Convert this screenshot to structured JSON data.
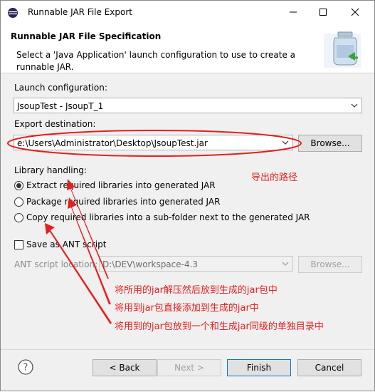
{
  "window": {
    "title": "Runnable JAR File Export"
  },
  "header": {
    "title": "Runnable JAR File Specification",
    "description": "Select a 'Java Application' launch configuration to use to create a runnable JAR."
  },
  "launch": {
    "label": "Launch configuration:",
    "value": "JsoupTest - JsoupT_1"
  },
  "export": {
    "label": "Export destination:",
    "value": "e:\\Users\\Administrator\\Desktop\\JsoupTest.jar",
    "browse_label": "Browse..."
  },
  "library": {
    "label": "Library handling:",
    "options": [
      {
        "label": "Extract required libraries into generated JAR",
        "selected": true
      },
      {
        "label": "Package required libraries into generated JAR",
        "selected": false
      },
      {
        "label": "Copy required libraries into a sub-folder next to the generated JAR",
        "selected": false
      }
    ]
  },
  "ant": {
    "checkbox_label": "Save as ANT script",
    "checked": false,
    "location_label": "ANT script location:",
    "location_value": "D:\\DEV\\workspace-4.3",
    "browse_label": "Browse..."
  },
  "buttons": {
    "back": "< Back",
    "next": "Next >",
    "finish": "Finish",
    "cancel": "Cancel"
  },
  "annotations": {
    "export_path_note": "导出的路径",
    "opt1_note": "将所用的jar解压然后放到生成的jar包中",
    "opt2_note": "将用到jar包直接添加到生成的jar中",
    "opt3_note": "将用到的jar包放到一个和生成jar同级的单独目录中",
    "color": "#e61e1e"
  }
}
